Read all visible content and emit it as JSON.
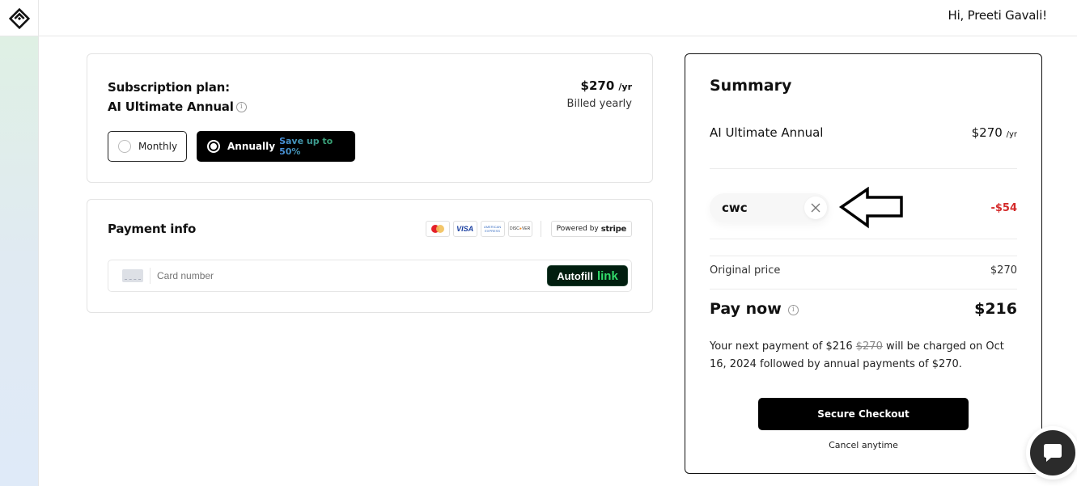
{
  "header": {
    "greeting": "Hi, Preeti Gavali!"
  },
  "plan": {
    "label": "Subscription plan:",
    "name": "AI Ultimate Annual",
    "price": "$270",
    "period": "/yr",
    "billing": "Billed yearly",
    "options": [
      {
        "label": "Monthly",
        "selected": false
      },
      {
        "label": "Annually",
        "selected": true,
        "badge": "Save up to 50%"
      }
    ]
  },
  "payment": {
    "title": "Payment info",
    "brands": [
      "mastercard",
      "visa",
      "american-express",
      "discover"
    ],
    "powered_by": "Powered by",
    "powered_brand": "stripe",
    "card_placeholder": "Card number",
    "autofill_label": "Autofill",
    "autofill_brand": "link"
  },
  "summary": {
    "title": "Summary",
    "plan_name": "AI Ultimate Annual",
    "plan_price": "$270",
    "plan_period": "/yr",
    "coupon_code": "cwc",
    "discount": "-$54",
    "original_label": "Original price",
    "original_value": "$270",
    "pay_now_label": "Pay now",
    "pay_now_value": "$216",
    "next_payment_prefix": "Your next payment of $216",
    "next_payment_strike": "$270",
    "next_payment_suffix": "will be charged on Oct 16, 2024 followed by annual payments of $270.",
    "checkout_label": "Secure Checkout",
    "cancel_note": "Cancel anytime"
  },
  "colors": {
    "discount": "#d42a2a",
    "autofill_bg": "#011e0f",
    "autofill_link": "#33dd6b",
    "primary_button": "#000000"
  }
}
